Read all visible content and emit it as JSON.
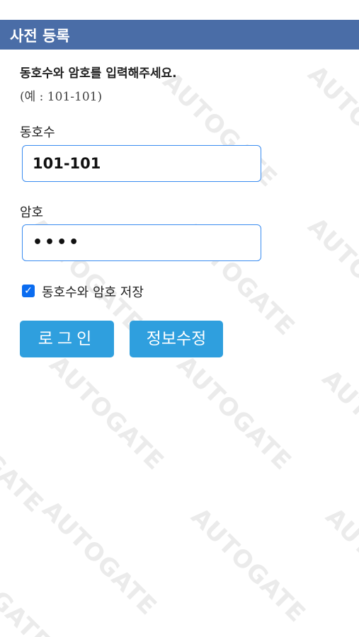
{
  "header": {
    "title": "사전 등록"
  },
  "form": {
    "instruction": "동호수와 암호를 입력해주세요.",
    "example": "(예 : 101-101)",
    "unit_label": "동호수",
    "unit_value": "101-101",
    "password_label": "암호",
    "password_value": "••••",
    "remember_label": "동호수와 암호 저장",
    "remember_checked": true
  },
  "buttons": {
    "login": "로그인",
    "edit_info": "정보수정"
  },
  "watermark": {
    "text": "AUTOGATE"
  },
  "colors": {
    "header_bg": "#4a6da7",
    "button_bg": "#2f9fde",
    "input_border": "#3a8cf0",
    "checkbox": "#0a6cf0"
  }
}
